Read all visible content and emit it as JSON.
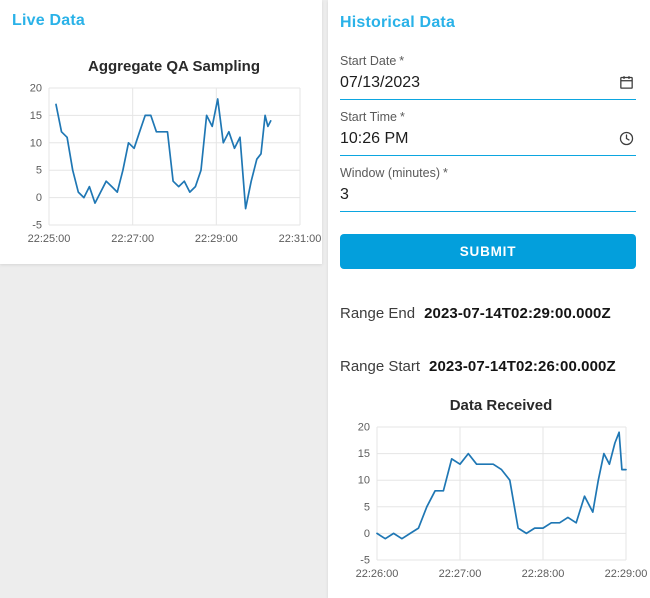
{
  "colors": {
    "heading_accent": "#2ab2e8",
    "button_bg": "#039fdc",
    "input_underline": "#0ca6e0",
    "chart_line": "#1f77b4",
    "grid": "#e5e5e5"
  },
  "live_panel": {
    "title": "Live Data"
  },
  "historical_panel": {
    "title": "Historical Data",
    "form": {
      "start_date": {
        "label": "Start Date",
        "required_mark": "*",
        "value": "07/13/2023",
        "icon": "calendar-icon"
      },
      "start_time": {
        "label": "Start Time",
        "required_mark": "*",
        "value": "10:26 PM",
        "icon": "clock-icon"
      },
      "window_minutes": {
        "label": "Window (minutes)",
        "required_mark": "*",
        "value": "3"
      }
    },
    "submit_label": "SUBMIT",
    "range_end": {
      "label": "Range End",
      "value": "2023-07-14T02:29:00.000Z"
    },
    "range_start": {
      "label": "Range Start",
      "value": "2023-07-14T02:26:00.000Z"
    }
  },
  "chart_data": [
    {
      "type": "line",
      "title": "Aggregate QA Sampling",
      "x_unit": "seconds after 22:25:00",
      "xlim": [
        0,
        360
      ],
      "ylim": [
        -5,
        20
      ],
      "xticks": [
        0,
        120,
        240,
        360
      ],
      "xtick_labels": [
        "22:25:00",
        "22:27:00",
        "22:29:00",
        "22:31:00"
      ],
      "yticks": [
        -5,
        0,
        5,
        10,
        15,
        20
      ],
      "grid": true,
      "line_color": "#1f77b4",
      "x": [
        10,
        18,
        26,
        34,
        42,
        50,
        58,
        66,
        74,
        82,
        90,
        98,
        106,
        114,
        122,
        130,
        138,
        146,
        154,
        162,
        170,
        178,
        186,
        194,
        202,
        210,
        218,
        226,
        234,
        242,
        250,
        258,
        266,
        274,
        282,
        290,
        298,
        304,
        310,
        314,
        318
      ],
      "y": [
        17,
        12,
        11,
        5,
        1,
        0,
        2,
        -1,
        1,
        3,
        2,
        1,
        5,
        10,
        9,
        12,
        15,
        15,
        12,
        12,
        12,
        3,
        2,
        3,
        1,
        2,
        5,
        15,
        13,
        18,
        10,
        12,
        9,
        11,
        -2,
        3,
        7,
        8,
        15,
        13,
        14
      ]
    },
    {
      "type": "line",
      "title": "Data Received",
      "x_unit": "seconds after 22:26:00",
      "xlim": [
        0,
        180
      ],
      "ylim": [
        -5,
        20
      ],
      "xticks": [
        0,
        60,
        120,
        180
      ],
      "xtick_labels": [
        "22:26:00",
        "22:27:00",
        "22:28:00",
        "22:29:00"
      ],
      "yticks": [
        -5,
        0,
        5,
        10,
        15,
        20
      ],
      "grid": true,
      "line_color": "#1f77b4",
      "x": [
        0,
        6,
        12,
        18,
        24,
        30,
        36,
        42,
        48,
        54,
        60,
        66,
        72,
        78,
        84,
        90,
        96,
        102,
        108,
        114,
        120,
        126,
        132,
        138,
        144,
        150,
        156,
        160,
        164,
        168,
        172,
        175,
        177,
        180
      ],
      "y": [
        0,
        -1,
        0,
        -1,
        0,
        1,
        5,
        8,
        8,
        14,
        13,
        15,
        13,
        13,
        13,
        12,
        10,
        1,
        0,
        1,
        1,
        2,
        2,
        3,
        2,
        7,
        4,
        10,
        15,
        13,
        17,
        19,
        12,
        12
      ]
    }
  ]
}
